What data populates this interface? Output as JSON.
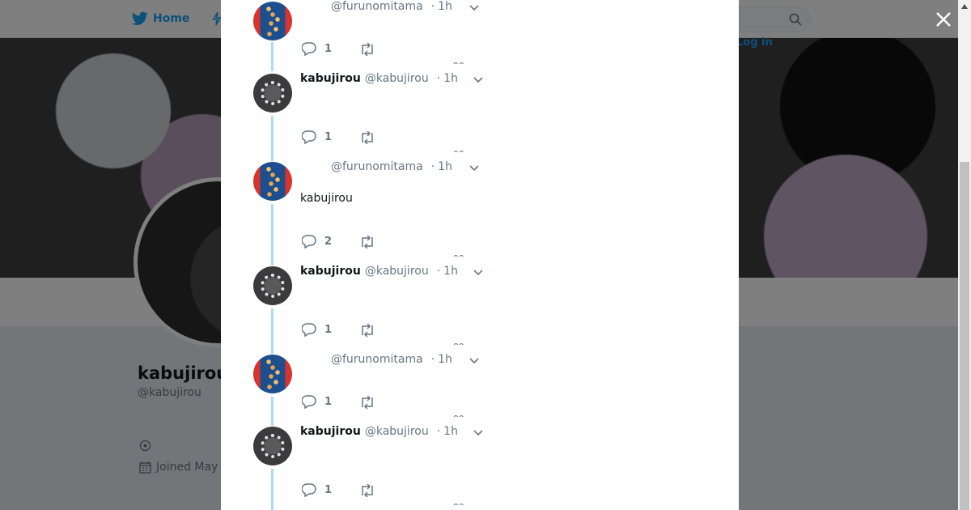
{
  "background": {
    "nav": {
      "home_label": "Home",
      "login_label": "Log in"
    },
    "profile": {
      "name": "kabujirou",
      "handle": "@kabujirou",
      "joined_text": "Joined May"
    }
  },
  "modal": {
    "tweets": [
      {
        "fullname": "",
        "handle": "@furunomitama",
        "time": "1h",
        "text": "",
        "reply_count": "1",
        "avatar": "furunomitama"
      },
      {
        "fullname": "kabujirou",
        "handle": "@kabujirou",
        "time": "1h",
        "text": "",
        "reply_count": "1",
        "avatar": "kabujirou"
      },
      {
        "fullname": "",
        "handle": "@furunomitama",
        "time": "1h",
        "text": "kabujirou",
        "reply_count": "2",
        "avatar": "furunomitama"
      },
      {
        "fullname": "kabujirou",
        "handle": "@kabujirou",
        "time": "1h",
        "text": "",
        "reply_count": "1",
        "avatar": "kabujirou"
      },
      {
        "fullname": "",
        "handle": "@furunomitama",
        "time": "1h",
        "text": "",
        "reply_count": "1",
        "avatar": "furunomitama"
      },
      {
        "fullname": "kabujirou",
        "handle": "@kabujirou",
        "time": "1h",
        "text": "",
        "reply_count": "1",
        "avatar": "kabujirou"
      }
    ]
  },
  "colors": {
    "accent": "#1da1f2",
    "thread_line": "#a9dcf5",
    "text_primary": "#14171a",
    "text_secondary": "#657786"
  },
  "icons": [
    "twitter-bird-icon",
    "lightning-icon",
    "search-icon",
    "close-icon",
    "reply-icon",
    "retweet-icon",
    "chevron-down-icon",
    "location-icon",
    "calendar-icon"
  ]
}
